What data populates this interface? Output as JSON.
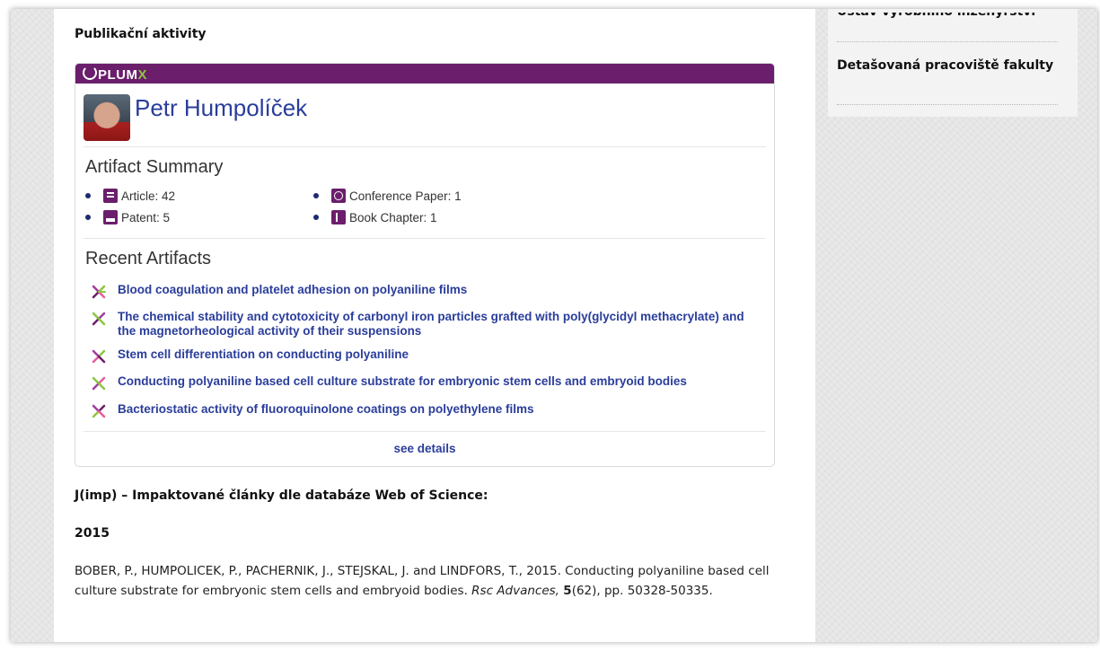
{
  "section": {
    "heading": "Publikační aktivity"
  },
  "plumx": {
    "logo_prefix": "PLUM",
    "logo_suffix": "X",
    "profile_name": "Petr Humpolíček",
    "artifact_summary_title": "Artifact Summary",
    "summary": [
      {
        "label": "Article: 42",
        "icon": "article-icon",
        "color": "#6b1e6b"
      },
      {
        "label": "Patent: 5",
        "icon": "patent-icon",
        "color": "#6b1e6b"
      },
      {
        "label": "Conference Paper: 1",
        "icon": "conference-paper-icon",
        "color": "#6b1e6b"
      },
      {
        "label": "Book Chapter: 1",
        "icon": "book-chapter-icon",
        "color": "#6b1e6b"
      }
    ],
    "recent_title": "Recent Artifacts",
    "recent": [
      {
        "title": "Blood coagulation and platelet adhesion on polyaniline films"
      },
      {
        "title": "The chemical stability and cytotoxicity of carbonyl iron particles grafted with poly(glycidyl methacrylate) and the magnetorheological activity of their suspensions"
      },
      {
        "title": "Stem cell differentiation on conducting polyaniline"
      },
      {
        "title": "Conducting polyaniline based cell culture substrate for embryonic stem cells and embryoid bodies"
      },
      {
        "title": "Bacteriostatic activity of fluoroquinolone coatings on polyethylene films"
      }
    ],
    "see_details": "see details",
    "colors": {
      "bar": "#6b1e6b",
      "link": "#2a3d9b",
      "accent_green": "#8cc63f"
    }
  },
  "publications": {
    "heading": "J(imp) – Impaktované články dle databáze Web of Science:",
    "year": "2015",
    "citation": {
      "authors_text": "BOBER, P., HUMPOLICEK, P., PACHERNIK, J., STEJSKAL, J. and LINDFORS, T., 2015. Conducting polyaniline based cell culture substrate for embryonic stem cells and embryoid bodies.",
      "journal": "Rsc Advances,",
      "volume": "5",
      "issue_pages": "(62), pp. 50328-50335."
    }
  },
  "sidebar": {
    "items": [
      {
        "label": "Ústav výrobního inženýrství"
      },
      {
        "label": "Detašovaná pracoviště fakulty"
      }
    ]
  }
}
